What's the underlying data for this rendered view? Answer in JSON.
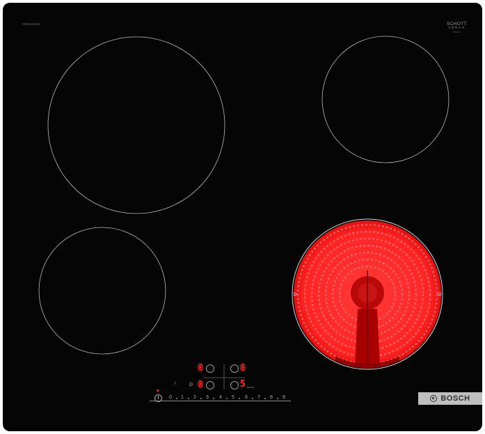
{
  "appliance": {
    "model_code": "PKE611K17E",
    "glass": {
      "line1": "SCHOTT",
      "line2": "CERAN",
      "line3": "CERAN"
    },
    "brand": "BOSCH"
  },
  "cooking_zones": [
    {
      "id": "front-left-rear",
      "state": "off"
    },
    {
      "id": "rear-right",
      "state": "off"
    },
    {
      "id": "front-left",
      "state": "off"
    },
    {
      "id": "front-right",
      "state": "heating",
      "glow_color": "#ff2a2a"
    }
  ],
  "displays": {
    "rear_left": "0",
    "rear_right": "0",
    "front_left": "0",
    "front_right": "5"
  },
  "power_scale": {
    "labels": [
      "0",
      "1",
      "2",
      "3",
      "4",
      "5",
      "6",
      "7",
      "8",
      "9"
    ]
  },
  "icons": {
    "power": "power-icon",
    "timer": "timer-icon",
    "childlock": "childlock-icon",
    "boost": "boost-icon"
  },
  "boost_label": "BOOST",
  "colors": {
    "glass": "#050505",
    "ring": "#bdbdbd",
    "display_red": "#ff2a2a",
    "logo_plate": "#bfbfbf"
  }
}
